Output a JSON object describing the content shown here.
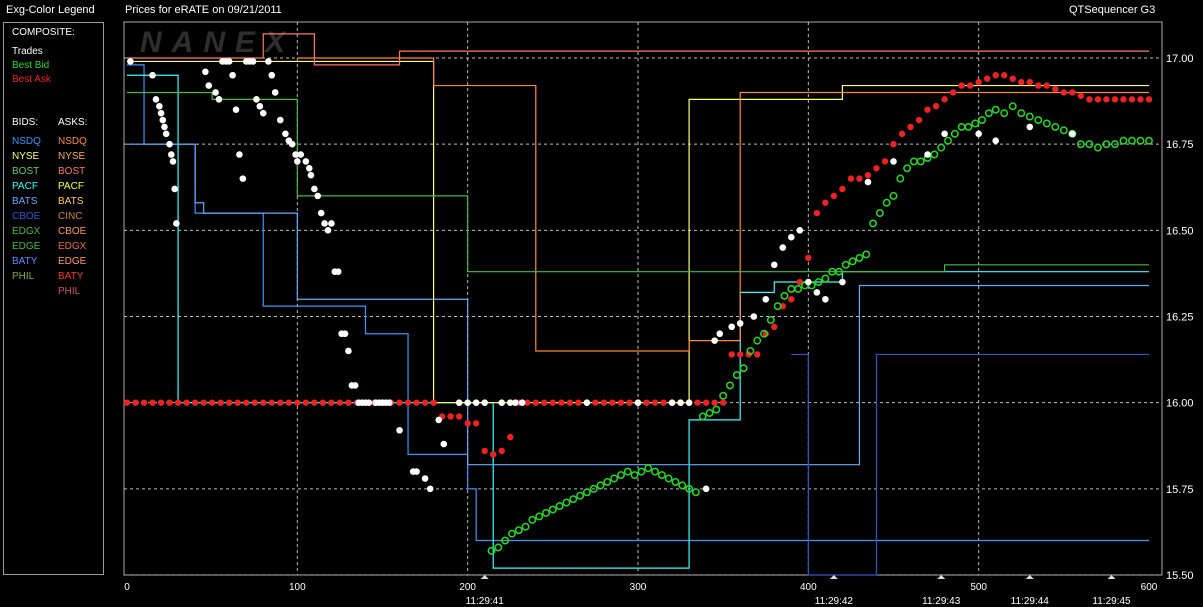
{
  "header": {
    "legend_title": "Exg-Color Legend",
    "chart_title": "Prices for  eRATE  on  09/21/2011",
    "app_name": "QTSequencer G3",
    "watermark": "NANEX"
  },
  "legend": {
    "composite_heading": "COMPOSITE:",
    "composite": [
      {
        "label": "Trades",
        "color": "#ffffff"
      },
      {
        "label": "Best Bid",
        "color": "#22dd22"
      },
      {
        "label": "Best Ask",
        "color": "#ee2222"
      }
    ],
    "bids_heading": "BIDS:",
    "asks_heading": "ASKS:",
    "bids": [
      {
        "label": "NSDQ",
        "color": "#3399ff"
      },
      {
        "label": "NYSE",
        "color": "#ffff66"
      },
      {
        "label": "BOST",
        "color": "#66cc66"
      },
      {
        "label": "PACF",
        "color": "#33ffff"
      },
      {
        "label": "BATS",
        "color": "#66aaff"
      },
      {
        "label": "CBOE",
        "color": "#3355cc"
      },
      {
        "label": "EDGX",
        "color": "#44bb44"
      },
      {
        "label": "EDGE",
        "color": "#44bb44"
      },
      {
        "label": "BATY",
        "color": "#6688ff"
      },
      {
        "label": "PHIL",
        "color": "#88aa33"
      }
    ],
    "asks": [
      {
        "label": "NSDQ",
        "color": "#ff8833"
      },
      {
        "label": "NYSE",
        "color": "#ffaa55"
      },
      {
        "label": "BOST",
        "color": "#ff7766"
      },
      {
        "label": "PACF",
        "color": "#ffff33"
      },
      {
        "label": "BATS",
        "color": "#ffcc66"
      },
      {
        "label": "CINC",
        "color": "#cc8844"
      },
      {
        "label": "CBOE",
        "color": "#ff9955"
      },
      {
        "label": "EDGX",
        "color": "#ee6644"
      },
      {
        "label": "EDGE",
        "color": "#ff9966"
      },
      {
        "label": "BATY",
        "color": "#ff3322"
      },
      {
        "label": "PHIL",
        "color": "#cc5555"
      }
    ]
  },
  "chart_data": {
    "type": "scatter",
    "title": "Prices for  eRATE  on  09/21/2011",
    "xlim": [
      0,
      600
    ],
    "ylim": [
      15.5,
      17.1
    ],
    "x_ticks": [
      0,
      100,
      200,
      300,
      400,
      500,
      600
    ],
    "x_tick_labels": [
      "0",
      "100",
      "200",
      "300",
      "400",
      "500",
      "600"
    ],
    "time_labels": [
      {
        "x": 210,
        "label": "11:29:41"
      },
      {
        "x": 415,
        "label": "11:29:42"
      },
      {
        "x": 478,
        "label": "11:29:43"
      },
      {
        "x": 530,
        "label": "11:29:44"
      },
      {
        "x": 578,
        "label": "11:29:45"
      }
    ],
    "y_ticks": [
      15.5,
      15.75,
      16.0,
      16.25,
      16.5,
      16.75,
      17.0
    ],
    "y_tick_labels": [
      "15.50",
      "15.75",
      "16.00",
      "16.25",
      "16.50",
      "16.75",
      "17.00"
    ],
    "grid": true,
    "trades": {
      "name": "Trades",
      "color": "#ffffff",
      "x": [
        2,
        15,
        17,
        19,
        20,
        21,
        22,
        23,
        25,
        26,
        27,
        28,
        29,
        46,
        48,
        52,
        54,
        56,
        58,
        60,
        62,
        64,
        66,
        68,
        70,
        72,
        74,
        76,
        78,
        80,
        83,
        85,
        87,
        90,
        93,
        95,
        97,
        99,
        100,
        102,
        105,
        107,
        108,
        110,
        112,
        114,
        116,
        118,
        120,
        122,
        124,
        126,
        128,
        130,
        132,
        134,
        136,
        138,
        140,
        142,
        146,
        148,
        150,
        152,
        154,
        160,
        168,
        170,
        175,
        178,
        183,
        186,
        195,
        200,
        205,
        210,
        220,
        225,
        228,
        232,
        270,
        300,
        320,
        325,
        330,
        340,
        345,
        348,
        355,
        360,
        368,
        375,
        380,
        385,
        390,
        395,
        400,
        405,
        410,
        420,
        435,
        450,
        470,
        480,
        500,
        510,
        530,
        555
      ],
      "y": [
        16.99,
        16.95,
        16.88,
        16.86,
        16.84,
        16.82,
        16.8,
        16.78,
        16.75,
        16.72,
        16.7,
        16.62,
        16.52,
        16.96,
        16.92,
        16.9,
        16.88,
        16.99,
        16.99,
        16.99,
        16.95,
        16.85,
        16.72,
        16.65,
        16.99,
        16.99,
        16.99,
        16.88,
        16.86,
        16.84,
        16.99,
        16.95,
        16.9,
        16.82,
        16.78,
        16.76,
        16.75,
        16.72,
        16.7,
        16.72,
        16.7,
        16.68,
        16.66,
        16.62,
        16.6,
        16.55,
        16.52,
        16.5,
        16.52,
        16.38,
        16.38,
        16.2,
        16.2,
        16.15,
        16.05,
        16.05,
        16.0,
        16.0,
        16.0,
        16.0,
        16.0,
        16.0,
        16.0,
        16.0,
        16.0,
        15.92,
        15.8,
        15.8,
        15.78,
        15.75,
        15.95,
        15.88,
        16.0,
        16.0,
        16.0,
        16.0,
        16.0,
        16.0,
        16.0,
        16.0,
        16.0,
        16.0,
        16.0,
        16.0,
        16.0,
        15.75,
        16.18,
        16.2,
        16.22,
        16.23,
        16.25,
        16.3,
        16.4,
        16.45,
        16.48,
        16.5,
        16.35,
        16.32,
        16.3,
        16.35,
        16.64,
        16.7,
        16.72,
        16.78,
        16.78,
        16.76,
        16.8,
        16.78
      ]
    },
    "best_bid": {
      "name": "Best Bid",
      "color": "#22dd22",
      "x": [
        214,
        218,
        222,
        226,
        230,
        234,
        238,
        242,
        246,
        250,
        254,
        258,
        262,
        266,
        270,
        274,
        278,
        282,
        286,
        290,
        294,
        298,
        302,
        306,
        310,
        314,
        318,
        322,
        326,
        330,
        334,
        338,
        342,
        346,
        350,
        354,
        358,
        362,
        366,
        370,
        374,
        378,
        382,
        386,
        390,
        394,
        398,
        402,
        406,
        410,
        414,
        418,
        422,
        426,
        430,
        434,
        438,
        442,
        446,
        450,
        454,
        458,
        462,
        466,
        470,
        474,
        478,
        482,
        486,
        490,
        494,
        498,
        502,
        506,
        510,
        515,
        520,
        525,
        530,
        535,
        540,
        545,
        550,
        555,
        560,
        565,
        570,
        575,
        580,
        585,
        590,
        595,
        600
      ],
      "y": [
        15.57,
        15.58,
        15.6,
        15.62,
        15.63,
        15.64,
        15.66,
        15.67,
        15.68,
        15.69,
        15.7,
        15.71,
        15.72,
        15.73,
        15.74,
        15.75,
        15.76,
        15.77,
        15.78,
        15.79,
        15.8,
        15.79,
        15.8,
        15.81,
        15.8,
        15.79,
        15.78,
        15.77,
        15.76,
        15.75,
        15.74,
        15.96,
        15.97,
        15.98,
        16.02,
        16.05,
        16.08,
        16.1,
        16.15,
        16.18,
        16.2,
        16.24,
        16.28,
        16.31,
        16.33,
        16.33,
        16.34,
        16.34,
        16.35,
        16.36,
        16.38,
        16.38,
        16.4,
        16.41,
        16.42,
        16.43,
        16.52,
        16.55,
        16.58,
        16.6,
        16.65,
        16.68,
        16.7,
        16.7,
        16.71,
        16.72,
        16.74,
        16.76,
        16.78,
        16.8,
        16.8,
        16.81,
        16.82,
        16.84,
        16.85,
        16.84,
        16.86,
        16.84,
        16.83,
        16.82,
        16.81,
        16.8,
        16.79,
        16.78,
        16.75,
        16.75,
        16.74,
        16.75,
        16.75,
        16.76,
        16.76,
        16.76,
        16.76
      ]
    },
    "best_ask": {
      "name": "Best Ask",
      "color": "#ee2222",
      "x": [
        0,
        5,
        10,
        15,
        20,
        25,
        30,
        35,
        40,
        45,
        50,
        55,
        60,
        65,
        70,
        75,
        80,
        85,
        90,
        95,
        100,
        105,
        110,
        115,
        120,
        125,
        130,
        135,
        140,
        145,
        150,
        155,
        160,
        165,
        170,
        175,
        180,
        185,
        190,
        195,
        200,
        205,
        210,
        215,
        220,
        225,
        230,
        235,
        240,
        245,
        250,
        255,
        260,
        265,
        270,
        275,
        280,
        285,
        290,
        295,
        300,
        305,
        310,
        315,
        320,
        325,
        330,
        335,
        340,
        345,
        350,
        355,
        360,
        365,
        370,
        375,
        380,
        385,
        390,
        395,
        400,
        405,
        410,
        415,
        420,
        425,
        430,
        435,
        440,
        445,
        450,
        455,
        460,
        465,
        470,
        475,
        480,
        485,
        490,
        495,
        500,
        505,
        510,
        515,
        520,
        525,
        530,
        535,
        540,
        545,
        550,
        555,
        560,
        565,
        570,
        575,
        580,
        585,
        590,
        595,
        600
      ],
      "y": [
        16.0,
        16.0,
        16.0,
        16.0,
        16.0,
        16.0,
        16.0,
        16.0,
        16.0,
        16.0,
        16.0,
        16.0,
        16.0,
        16.0,
        16.0,
        16.0,
        16.0,
        16.0,
        16.0,
        16.0,
        16.0,
        16.0,
        16.0,
        16.0,
        16.0,
        16.0,
        16.0,
        16.0,
        16.0,
        16.0,
        16.0,
        16.0,
        16.0,
        16.0,
        16.0,
        16.0,
        16.0,
        15.96,
        15.96,
        15.96,
        15.94,
        15.94,
        15.86,
        15.85,
        15.86,
        15.9,
        16.0,
        16.0,
        16.0,
        16.0,
        16.0,
        16.0,
        16.0,
        16.0,
        16.0,
        16.0,
        16.0,
        16.0,
        16.0,
        16.0,
        16.0,
        16.0,
        16.0,
        16.0,
        16.0,
        16.0,
        16.0,
        16.0,
        16.0,
        16.0,
        16.0,
        16.14,
        16.14,
        16.14,
        16.14,
        16.2,
        16.22,
        16.28,
        16.3,
        16.35,
        16.42,
        16.55,
        16.58,
        16.6,
        16.62,
        16.65,
        16.65,
        16.66,
        16.68,
        16.7,
        16.75,
        16.78,
        16.8,
        16.82,
        16.85,
        16.86,
        16.88,
        16.9,
        16.92,
        16.92,
        16.93,
        16.94,
        16.95,
        16.95,
        16.94,
        16.93,
        16.93,
        16.92,
        16.92,
        16.91,
        16.9,
        16.9,
        16.89,
        16.88,
        16.88,
        16.88,
        16.88,
        16.88,
        16.88,
        16.88,
        16.88
      ]
    },
    "quote_steps": [
      {
        "name": "NSDQ bid",
        "color": "#3399ff",
        "x": [
          0,
          10,
          10,
          40,
          40,
          80,
          80,
          140,
          140,
          165,
          165,
          200,
          200,
          205,
          205,
          600
        ],
        "y": [
          16.98,
          16.98,
          16.75,
          16.75,
          16.55,
          16.55,
          16.28,
          16.28,
          16.2,
          16.2,
          15.85,
          15.85,
          15.75,
          15.75,
          15.6,
          15.6
        ]
      },
      {
        "name": "PACF bid",
        "color": "#33ffff",
        "x": [
          0,
          30,
          30,
          215,
          215,
          330,
          330,
          360,
          360,
          380,
          380,
          420,
          420,
          600
        ],
        "y": [
          16.95,
          16.95,
          16.0,
          16.0,
          15.52,
          15.52,
          15.95,
          15.95,
          16.32,
          16.32,
          16.35,
          16.35,
          16.38,
          16.38
        ]
      },
      {
        "name": "BATS bid",
        "color": "#66aaff",
        "x": [
          0,
          40,
          40,
          45,
          45,
          100,
          100,
          200,
          200,
          430,
          430,
          600
        ],
        "y": [
          16.75,
          16.75,
          16.58,
          16.58,
          16.55,
          16.55,
          16.3,
          16.3,
          15.82,
          15.82,
          16.34,
          16.34
        ]
      },
      {
        "name": "NYSE ask",
        "color": "#ffff66",
        "x": [
          0,
          180,
          180,
          330,
          330,
          355,
          355,
          420,
          420,
          600
        ],
        "y": [
          16.99,
          16.99,
          16.0,
          16.0,
          16.88,
          16.88,
          16.88,
          16.88,
          16.92,
          16.92
        ]
      },
      {
        "name": "NSDQ ask",
        "color": "#ff8833",
        "x": [
          100,
          180,
          180,
          240,
          240,
          330,
          330,
          360,
          360,
          600
        ],
        "y": [
          17.0,
          17.0,
          16.92,
          16.92,
          16.15,
          16.15,
          16.18,
          16.18,
          16.9,
          16.9
        ]
      },
      {
        "name": "BOST ask",
        "color": "#ff7766",
        "x": [
          0,
          80,
          80,
          110,
          110,
          160,
          160,
          600
        ],
        "y": [
          17.0,
          17.0,
          17.07,
          17.07,
          16.98,
          16.98,
          17.02,
          17.02
        ]
      },
      {
        "name": "EDGX bid",
        "color": "#44bb44",
        "x": [
          0,
          50,
          50,
          100,
          100,
          200,
          200,
          480,
          480,
          600
        ],
        "y": [
          16.9,
          16.9,
          16.88,
          16.88,
          16.6,
          16.6,
          16.38,
          16.38,
          16.4,
          16.4
        ]
      },
      {
        "name": "BATY bid",
        "color": "#3355cc",
        "x": [
          390,
          400,
          400,
          440,
          440,
          600
        ],
        "y": [
          16.14,
          16.14,
          15.5,
          15.5,
          16.14,
          16.14
        ]
      }
    ]
  }
}
